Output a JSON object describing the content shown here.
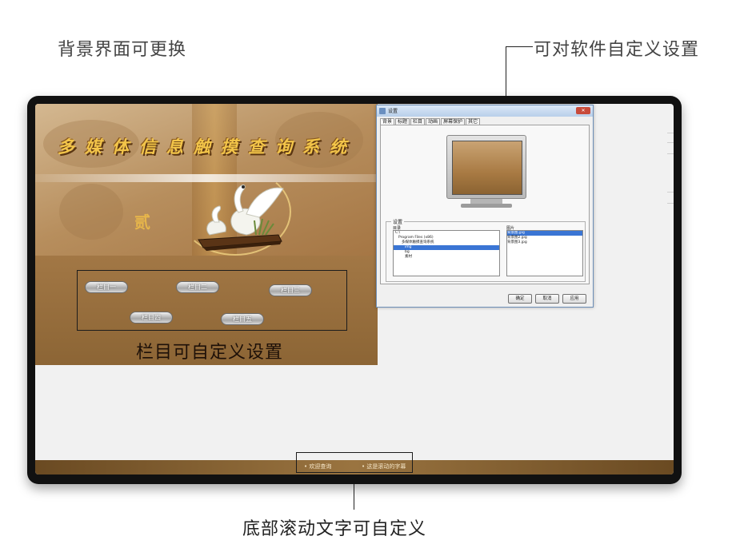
{
  "annotations": {
    "background_changeable": "背景界面可更换",
    "software_settings": "可对软件自定义设置",
    "menu_customizable": "栏目可自定义设置",
    "scroll_text_customizable": "底部滚动文字可自定义"
  },
  "app": {
    "title": "多媒体信息触摸查询系统",
    "menu_items": [
      "栏目一",
      "栏目二",
      "栏目三",
      "栏目四",
      "栏目五"
    ]
  },
  "bottom_bar": {
    "scroll_items": [
      "• 欢迎查询",
      "• 这是滚动的字幕"
    ]
  },
  "dialog": {
    "title": "设置",
    "close": "✕",
    "tabs": [
      "背景",
      "标题",
      "栏目",
      "动画",
      "屏幕保护",
      "其它"
    ],
    "group_label": "设置",
    "dir_label": "目录",
    "pic_label": "图片",
    "tree": [
      {
        "label": "C:\\",
        "selected": false
      },
      {
        "label": "Program Files (x86)",
        "selected": false
      },
      {
        "label": "多媒体触摸查询系统",
        "selected": false
      },
      {
        "label": "img",
        "selected": true
      },
      {
        "label": "bg",
        "selected": false
      },
      {
        "label": "素材",
        "selected": false
      }
    ],
    "pictures": [
      {
        "label": "背景图.jpg",
        "selected": true
      },
      {
        "label": "背景图2.jpg",
        "selected": false
      },
      {
        "label": "背景图3.jpg",
        "selected": false
      }
    ],
    "buttons": {
      "ok": "确定",
      "cancel": "取消",
      "apply": "应用"
    }
  }
}
